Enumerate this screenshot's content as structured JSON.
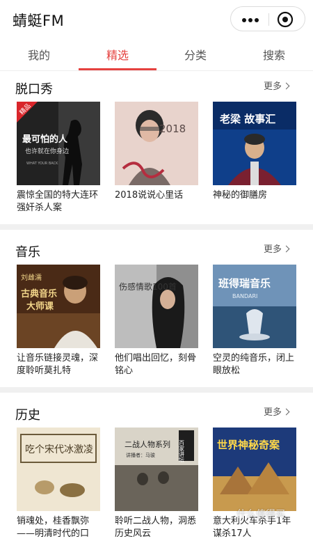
{
  "app": {
    "title": "蜻蜓FM"
  },
  "tabs": [
    {
      "label": "我的"
    },
    {
      "label": "精选"
    },
    {
      "label": "分类"
    },
    {
      "label": "搜索"
    }
  ],
  "sections": [
    {
      "title": "脱口秀",
      "more": "更多",
      "items": [
        {
          "caption": "震惊全国的特大连环强奸杀人案",
          "cover_text": "最可怕的人",
          "cover_sub": "也许就在你身边",
          "badge": "精品",
          "cover_small": "WHAT YOUR BACK"
        },
        {
          "caption": "2018说说心里话",
          "cover_text": "2018"
        },
        {
          "caption": "神秘的御膳房",
          "cover_text": "老梁 故事汇"
        }
      ]
    },
    {
      "title": "音乐",
      "more": "更多",
      "items": [
        {
          "caption": "让音乐链接灵魂，深度聆听莫扎特",
          "cover_text": "古典音乐",
          "cover_sub": "大师课",
          "cover_name": "刘雌濡"
        },
        {
          "caption": "他们唱出回忆，刻骨铭心",
          "cover_text": "伤感情歌100首"
        },
        {
          "caption": "空灵的纯音乐，闭上眼放松",
          "cover_text": "班得瑞音乐",
          "cover_sub": "BANDARI"
        }
      ]
    },
    {
      "title": "历史",
      "more": "更多",
      "items": [
        {
          "caption": "销魂处，桂香飘弥——明清时代的口",
          "cover_text": "吃个宋代冰激凌"
        },
        {
          "caption": "聆听二战人物，洞悉历史风云",
          "cover_text": "二战人物系列",
          "cover_sub": "讲播者：马骏",
          "cover_tag": "百家讲坛"
        },
        {
          "caption": "意大利火车杀手1年谋杀17人",
          "cover_text": "世界神秘奇案"
        }
      ]
    }
  ],
  "watermark": "什么值得买",
  "colors": {
    "accent": "#e5413f"
  }
}
